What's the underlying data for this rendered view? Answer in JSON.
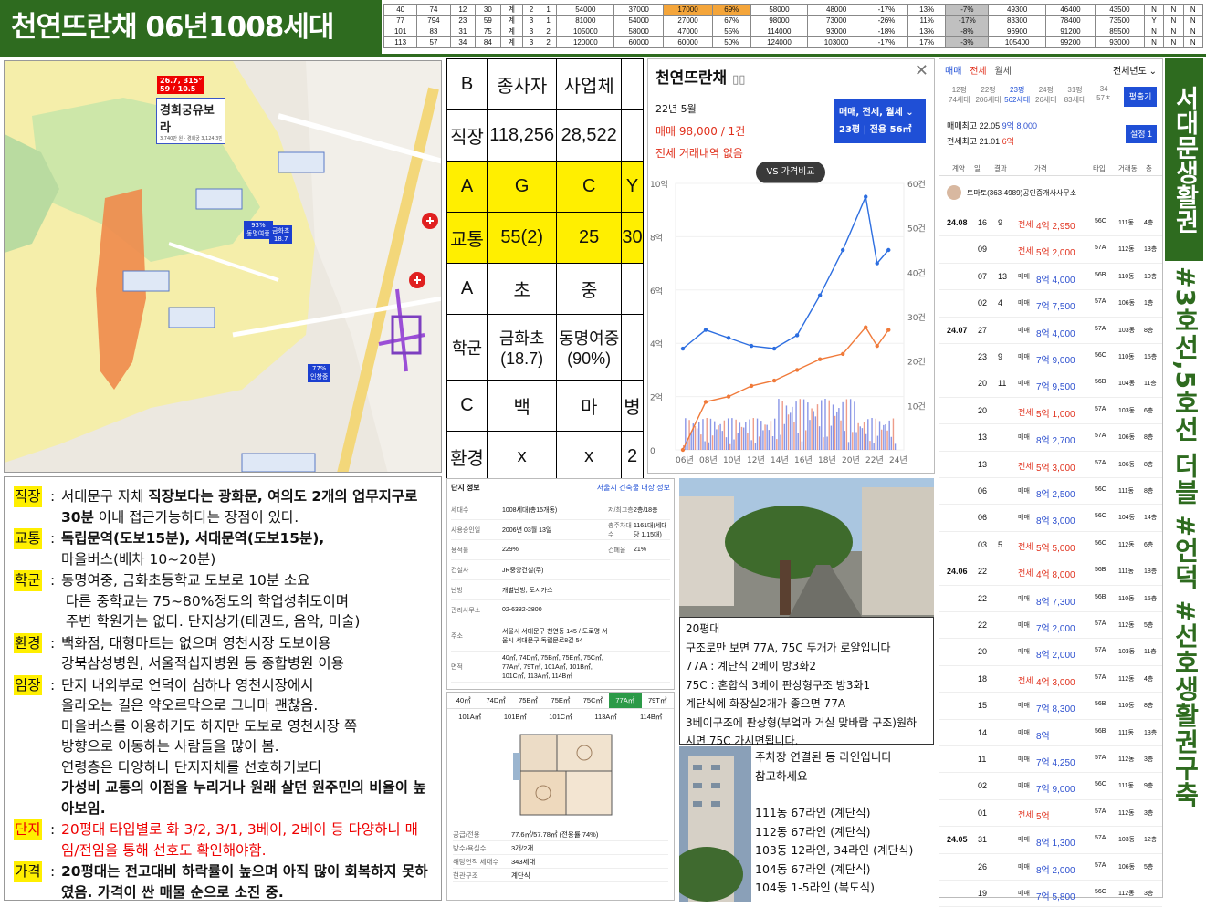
{
  "header": {
    "title": "천연뜨란채 06년1008세대"
  },
  "stats": [
    [
      "40",
      "74",
      "12",
      "30",
      "계",
      "2",
      "1",
      "54000",
      "37000",
      "17000",
      "69%",
      "58000",
      "48000",
      "-17%",
      "13%",
      "-7%",
      "49300",
      "46400",
      "43500",
      "N",
      "N",
      "N"
    ],
    [
      "77",
      "794",
      "23",
      "59",
      "계",
      "3",
      "1",
      "81000",
      "54000",
      "27000",
      "67%",
      "98000",
      "73000",
      "-26%",
      "11%",
      "-17%",
      "83300",
      "78400",
      "73500",
      "Y",
      "N",
      "N"
    ],
    [
      "101",
      "83",
      "31",
      "75",
      "계",
      "3",
      "2",
      "105000",
      "58000",
      "47000",
      "55%",
      "114000",
      "93000",
      "-18%",
      "13%",
      "-8%",
      "96900",
      "91200",
      "85500",
      "N",
      "N",
      "N"
    ],
    [
      "113",
      "57",
      "34",
      "84",
      "계",
      "3",
      "2",
      "120000",
      "60000",
      "60000",
      "50%",
      "124000",
      "103000",
      "-17%",
      "17%",
      "-3%",
      "105400",
      "99200",
      "93000",
      "N",
      "N",
      "N"
    ]
  ],
  "colors": {
    "green": "#2e6b1f",
    "yellow": "#ffef00",
    "orange": "#f4a53a",
    "red": "#e00000",
    "sale_blue": "#2c4fcf",
    "rent_red": "#e0301c"
  },
  "map": {
    "badge_line1": "26.7, 315°",
    "badge_line2": "59 / 10.5",
    "complex_name": "경희궁유보라",
    "complex_sub": "3,740만 원 · 경희궁 3,124.3만",
    "pin1_pct": "93%",
    "pin1_name": "동명여중",
    "pin2_name": "금화초",
    "pin2_score": "18.7",
    "pin3_pct": "77%",
    "pin3_name": "인창중"
  },
  "grid": {
    "rows": [
      [
        "B",
        "종사자",
        "사업체",
        ""
      ],
      [
        "직장",
        "118,256",
        "28,522",
        ""
      ],
      [
        "A",
        "G",
        "C",
        "Y"
      ],
      [
        "교통",
        "55(2)",
        "25",
        "30"
      ],
      [
        "A",
        "초",
        "중",
        ""
      ],
      [
        "학군",
        "금화초 (18.7)",
        "동명여중 (90%)",
        ""
      ],
      [
        "C",
        "백",
        "마",
        "병"
      ],
      [
        "환경",
        "x",
        "x",
        "2"
      ]
    ]
  },
  "chart_panel": {
    "title": "천연뜨란채",
    "book_icon": "book-icon",
    "period": "22년 5월",
    "sale_line": "매매 98,000 / 1건",
    "rent_line": "전세 거래내역 없음",
    "dropdown": "매매, 전세, 월세",
    "area": "23평 | 전용 56㎡",
    "compare_btn": "VS 가격비교"
  },
  "chart_data": {
    "type": "line",
    "x": [
      "06년",
      "08년",
      "10년",
      "12년",
      "14년",
      "16년",
      "18년",
      "20년",
      "22년",
      "24년"
    ],
    "left_axis": [
      "10억",
      "8억",
      "6억",
      "4억",
      "2억",
      "0"
    ],
    "right_axis": [
      "60건",
      "50건",
      "40건",
      "30건",
      "20건",
      "10건"
    ],
    "ylim": [
      0,
      10
    ],
    "series": [
      {
        "type": "sale",
        "values": [
          3.8,
          4.5,
          4.2,
          3.9,
          3.8,
          4.3,
          5.8,
          7.5,
          9.5,
          7.0,
          7.5
        ]
      },
      {
        "type": "jeonse",
        "values": [
          0,
          1.8,
          2.0,
          2.4,
          2.6,
          3.0,
          3.4,
          3.6,
          4.6,
          3.9,
          4.5
        ]
      }
    ],
    "years": [
      2006,
      2008,
      2010,
      2012,
      2014,
      2016,
      2018,
      2020,
      2022,
      2023,
      2024
    ]
  },
  "list": {
    "tabs": [
      "매매",
      "전세",
      "월세"
    ],
    "year_dd": "전체년도",
    "sizes": [
      {
        "py": "12평",
        "units": "74세대"
      },
      {
        "py": "22평",
        "units": "206세대"
      },
      {
        "py": "23평",
        "units": "562세대"
      },
      {
        "py": "24평",
        "units": "26세대"
      },
      {
        "py": "31평",
        "units": "83세대"
      },
      {
        "py": "34",
        "units": "57ㅊ"
      }
    ],
    "py_btn": "평출기",
    "set_btn": "설정 1",
    "max1": "매매최고 22.05",
    "max1_val": "9억 8,000",
    "max2": "전세최고 21.01",
    "max2_val": "6억",
    "cols": [
      "계약",
      "일",
      "결과",
      "가격",
      "타입",
      "거래동",
      "층"
    ],
    "broker": "토마토(363-4989)공인중개사사무소",
    "rows": [
      {
        "ym": "24.08",
        "d": "16",
        "r": "9",
        "kind": "전세",
        "price": "4억 2,950",
        "type": "56C",
        "dong": "111동",
        "fl": "4층"
      },
      {
        "ym": "",
        "d": "09",
        "r": "",
        "kind": "전세",
        "price": "5억 2,000",
        "type": "57A",
        "dong": "112동",
        "fl": "13층"
      },
      {
        "ym": "",
        "d": "07",
        "r": "13",
        "kind": "매매",
        "price": "8억 4,000",
        "type": "56B",
        "dong": "110동",
        "fl": "10층"
      },
      {
        "ym": "",
        "d": "02",
        "r": "4",
        "kind": "매매",
        "price": "7억 7,500",
        "type": "57A",
        "dong": "106동",
        "fl": "1층"
      },
      {
        "ym": "24.07",
        "d": "27",
        "r": "",
        "kind": "매매",
        "price": "8억 4,000",
        "type": "57A",
        "dong": "103동",
        "fl": "8층"
      },
      {
        "ym": "",
        "d": "23",
        "r": "9",
        "kind": "매매",
        "price": "7억 9,000",
        "type": "56C",
        "dong": "110동",
        "fl": "15층"
      },
      {
        "ym": "",
        "d": "20",
        "r": "11",
        "kind": "매매",
        "price": "7억 9,500",
        "type": "56B",
        "dong": "104동",
        "fl": "11층"
      },
      {
        "ym": "",
        "d": "20",
        "r": "",
        "kind": "전세",
        "price": "5억 1,000",
        "type": "57A",
        "dong": "103동",
        "fl": "6층"
      },
      {
        "ym": "",
        "d": "13",
        "r": "",
        "kind": "매매",
        "price": "8억 2,700",
        "type": "57A",
        "dong": "106동",
        "fl": "8층"
      },
      {
        "ym": "",
        "d": "13",
        "r": "",
        "kind": "전세",
        "price": "5억 3,000",
        "type": "57A",
        "dong": "106동",
        "fl": "8층"
      },
      {
        "ym": "",
        "d": "06",
        "r": "",
        "kind": "매매",
        "price": "8억 2,500",
        "type": "56C",
        "dong": "111동",
        "fl": "8층"
      },
      {
        "ym": "",
        "d": "06",
        "r": "",
        "kind": "매매",
        "price": "8억 3,000",
        "type": "56C",
        "dong": "104동",
        "fl": "14층"
      },
      {
        "ym": "",
        "d": "03",
        "r": "5",
        "kind": "전세",
        "price": "5억 5,000",
        "type": "56C",
        "dong": "112동",
        "fl": "6층"
      },
      {
        "ym": "24.06",
        "d": "22",
        "r": "",
        "kind": "전세",
        "price": "4억 8,000",
        "type": "56B",
        "dong": "111동",
        "fl": "18층"
      },
      {
        "ym": "",
        "d": "22",
        "r": "",
        "kind": "매매",
        "price": "8억 7,300",
        "type": "56B",
        "dong": "110동",
        "fl": "15층"
      },
      {
        "ym": "",
        "d": "22",
        "r": "",
        "kind": "매매",
        "price": "7억 2,000",
        "type": "57A",
        "dong": "112동",
        "fl": "5층"
      },
      {
        "ym": "",
        "d": "20",
        "r": "",
        "kind": "매매",
        "price": "8억 2,000",
        "type": "57A",
        "dong": "103동",
        "fl": "11층"
      },
      {
        "ym": "",
        "d": "18",
        "r": "",
        "kind": "전세",
        "price": "4억 3,000",
        "type": "57A",
        "dong": "112동",
        "fl": "4층"
      },
      {
        "ym": "",
        "d": "15",
        "r": "",
        "kind": "매매",
        "price": "7억 8,300",
        "type": "56B",
        "dong": "110동",
        "fl": "8층"
      },
      {
        "ym": "",
        "d": "14",
        "r": "",
        "kind": "매매",
        "price": "8억",
        "type": "56B",
        "dong": "111동",
        "fl": "13층"
      },
      {
        "ym": "",
        "d": "11",
        "r": "",
        "kind": "매매",
        "price": "7억 4,250",
        "type": "57A",
        "dong": "112동",
        "fl": "3층"
      },
      {
        "ym": "",
        "d": "02",
        "r": "",
        "kind": "매매",
        "price": "7억 9,000",
        "type": "56C",
        "dong": "111동",
        "fl": "9층"
      },
      {
        "ym": "",
        "d": "01",
        "r": "",
        "kind": "전세",
        "price": "5억",
        "type": "57A",
        "dong": "112동",
        "fl": "3층"
      },
      {
        "ym": "24.05",
        "d": "31",
        "r": "",
        "kind": "매매",
        "price": "8억 1,300",
        "type": "57A",
        "dong": "103동",
        "fl": "12층"
      },
      {
        "ym": "",
        "d": "26",
        "r": "",
        "kind": "매매",
        "price": "8억 2,000",
        "type": "57A",
        "dong": "106동",
        "fl": "5층"
      },
      {
        "ym": "",
        "d": "19",
        "r": "",
        "kind": "매매",
        "price": "7억 5,800",
        "type": "56C",
        "dong": "112동",
        "fl": "3층"
      }
    ]
  },
  "side": {
    "title": "서대문생활권",
    "hashtags": "#3호선,5호선 더블 #언덕 #선호생활권구축"
  },
  "notes": [
    {
      "label": "직장",
      "html": "서대문구 자체 <b>직장보다는 광화문, 여의도 2개의 업무지구로 30분</b> 이내 접근가능하다는 장점이 있다.",
      "red": false
    },
    {
      "label": "교통",
      "html": "<b>독립문역(도보15분), 서대문역(도보15분),</b><br>마을버스(배차 10~20분)",
      "red": false
    },
    {
      "label": "학군",
      "html": "동명여중, 금화초등학교 도보로 10분 소요<br>&nbsp;다른 중학교는 75~80%정도의 학업성취도이며<br>&nbsp;주변 학원가는 없다. 단지상가(태권도, 음악, 미술)",
      "red": false
    },
    {
      "label": "환경",
      "html": "백화점, 대형마트는 없으며 영천시장 도보이용<br>강북삼성병원, 서울적십자병원 등 종합병원 이용",
      "red": false
    },
    {
      "label": "임장",
      "html": "단지 내외부로 언덕이 심하나 영천시장에서<br>올라오는 길은 약오르막으로 그나마 괜찮음.<br>마을버스를 이용하기도 하지만 도보로 영천시장 쪽<br>방향으로 이동하는 사람들을 많이 봄.<br>연령층은 다양하나 단지자체를 선호하기보다<br><b>가성비 교통의 이점을 누리거나 원래 살던 원주민의 비율이 높아보임.</b>",
      "red": false
    },
    {
      "label": "단지",
      "html": "20평대 타입별로 화 3/2, 3/1, 3베이, 2베이 등 다양하니 매임/전임을 통해 선호도 확인해야함.",
      "red": true
    },
    {
      "label": "가격",
      "html": "<b>20평대는 전고대비 하락률이 높으며 아직 많이 회복하지 못하였음. 가격이 싼 매물 순으로 소진 중.</b>",
      "red": false
    }
  ],
  "info": {
    "title": "단지 정보",
    "link": "서울시 건축물 대장 정보",
    "rows": [
      [
        "세대수",
        "1008세대(총15개동)",
        "저/최고층",
        "2층/18층"
      ],
      [
        "사용승인일",
        "2006년 03월 13일",
        "총주차대수",
        "1161대(세대당 1.15대)"
      ],
      [
        "용적률",
        "229%",
        "건폐율",
        "21%"
      ],
      [
        "건설사",
        "JR중앙건설(주)",
        "",
        ""
      ],
      [
        "난방",
        "개별난방, 도시가스",
        "",
        ""
      ],
      [
        "관리사무소",
        "02-6382-2800",
        "",
        ""
      ],
      [
        "주소",
        "서울시 서대문구 천연동 145 / 도로명 서울시 서대문구 독립문로8길 54",
        "",
        ""
      ],
      [
        "면적",
        "40㎡, 74D㎡, 75B㎡, 75E㎡, 75C㎡, 77A㎡, 79T㎡, 101A㎡, 101B㎡, 101C㎡, 113A㎡, 114B㎡",
        "",
        ""
      ]
    ]
  },
  "plan": {
    "tabs1": [
      "40㎡",
      "74D㎡",
      "75B㎡",
      "75E㎡",
      "75C㎡",
      "77A㎡",
      "79T㎡"
    ],
    "tabs2": [
      "101A㎡",
      "101B㎡",
      "101C㎡",
      "113A㎡",
      "114B㎡"
    ],
    "rows": [
      [
        "공급/전용",
        "77.6㎡/57.78㎡ (전용률 74%)"
      ],
      [
        "방수/욕실수",
        "3개/2개"
      ],
      [
        "해당면적 세대수",
        "343세대"
      ],
      [
        "현관구조",
        "계단식"
      ]
    ]
  },
  "photo_note": {
    "lines": [
      "20평대",
      "구조로만 보면 77A, 75C 두개가 로얄입니다",
      "77A : 계단식 2베이 방3화2",
      "75C : 혼합식 3베이 판상형구조 방3화1",
      "계단식에 화장실2개가 좋으면 77A",
      "3베이구조에 판상형(부엌과 거실 맞바람 구조)원하",
      "시면 75C 가시면됩니다."
    ]
  },
  "photo_note2": {
    "lines": [
      "주차장 연결된 동 라인입니다",
      "참고하세요",
      "",
      "111동 67라인 (계단식)",
      "112동 67라인 (계단식)",
      "103동 12라인, 34라인 (계단식)",
      "104동 67라인 (계단식)",
      "104동 1-5라인 (복도식)"
    ]
  }
}
